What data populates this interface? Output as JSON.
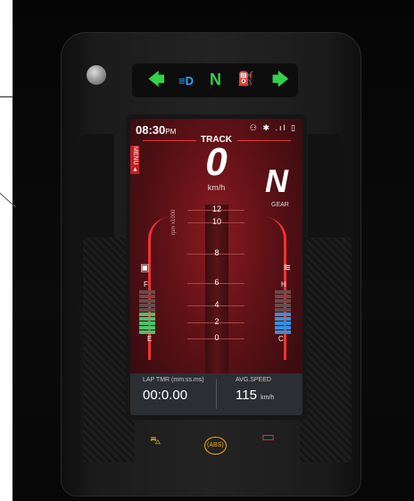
{
  "telltales": {
    "left_turn": "🡄",
    "headlight": "≡D",
    "neutral": "N",
    "fuel": "⛽",
    "right_turn": "🡆"
  },
  "status_bar": {
    "time": "08:30",
    "ampm": "PM",
    "icons": "⚇ ✱ .ıl ▯"
  },
  "mode": "TRACK",
  "menu_label": "MENU ▲",
  "speed": {
    "value": "0",
    "unit": "km/h"
  },
  "gear": {
    "value": "N",
    "label": "GEAR"
  },
  "rpm": {
    "unit": "rpm x1000",
    "ticks": [
      "12",
      "10",
      "8",
      "6",
      "4",
      "2",
      "0"
    ]
  },
  "fuel_gauge": {
    "icon": "▣",
    "full_label": "F",
    "empty_label": "E",
    "segments_total": 10,
    "segments_lit": 5,
    "color_lit": "#4fc06a",
    "color_unlit": "#6a4a4c"
  },
  "temp_gauge": {
    "icon": "≋",
    "hot_label": "H",
    "cold_label": "C",
    "segments_total": 10,
    "segments_lit": 5,
    "color_lit": "#3a8fd8",
    "color_unlit": "#6a4a4c"
  },
  "info": {
    "lap_label": "LAP TMR (mm:ss.ms)",
    "lap_value": "00:0.00",
    "avg_label": "AVG.SPEED",
    "avg_value": "115",
    "avg_unit": "km/h"
  },
  "bottom_indicators": {
    "engine": "⛍",
    "abs": "(ABS)",
    "battery": "▭"
  },
  "colors": {
    "telltale_green": "#35d04a",
    "telltale_blue": "#2aa7ff",
    "telltale_amber": "#f2a81d",
    "warning_red": "#e53a3a",
    "accent_red": "#e23a3a"
  }
}
